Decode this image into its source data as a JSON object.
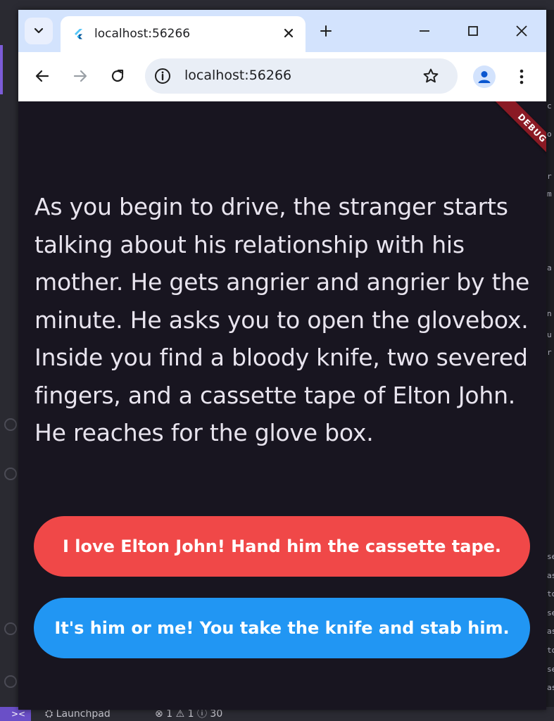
{
  "browser": {
    "tab": {
      "title": "localhost:56266"
    },
    "omnibox": {
      "url": "localhost:56266"
    }
  },
  "app": {
    "debug_banner": "DEBUG",
    "story_text": "As you begin to drive, the stranger starts talking about his relationship with his mother. He gets angrier and angrier by the minute. He asks you to open the glovebox. Inside you find a bloody knife, two severed fingers, and a cassette tape of Elton John. He reaches for the glove box.",
    "choices": [
      {
        "label": "I love Elton John! Hand him the cassette tape.",
        "color": "#f04848"
      },
      {
        "label": "It's him or me! You take the knife and stab him.",
        "color": "#2196f3"
      }
    ],
    "background_color": "#181520"
  },
  "statusbar": {
    "launchpad": "Launchpad",
    "errors": "1",
    "warnings": "1",
    "infos": "30"
  },
  "ide_right_edge_glyphs": [
    "o",
    "r",
    "m",
    "a",
    "n",
    "u",
    "r",
    "se",
    "as",
    "to",
    "se",
    "as",
    "to",
    "se",
    "as"
  ]
}
